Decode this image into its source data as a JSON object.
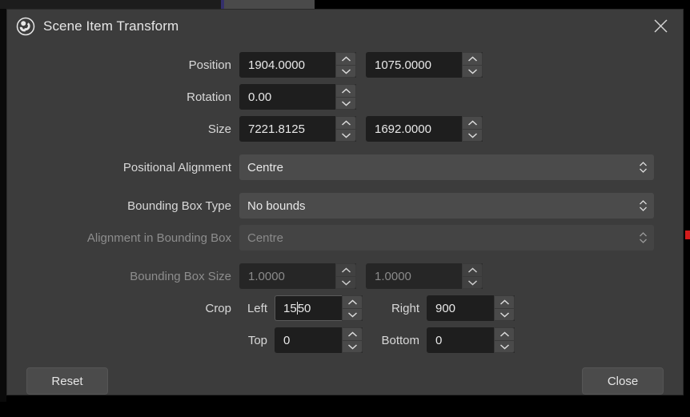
{
  "window": {
    "title": "Scene Item Transform",
    "logo_icon": "obs-logo-icon",
    "close_icon": "close-icon"
  },
  "form": {
    "position": {
      "label": "Position",
      "x_value": "1904.0000",
      "y_value": "1075.0000"
    },
    "rotation": {
      "label": "Rotation",
      "value": "0.00"
    },
    "size": {
      "label": "Size",
      "width_value": "7221.8125",
      "height_value": "1692.0000"
    },
    "positional_alignment": {
      "label": "Positional Alignment",
      "value": "Centre"
    },
    "bounding_box_type": {
      "label": "Bounding Box Type",
      "value": "No bounds"
    },
    "alignment_in_bounding_box": {
      "label": "Alignment in Bounding Box",
      "value": "Centre"
    },
    "bounding_box_size": {
      "label": "Bounding Box Size",
      "width_value": "1.0000",
      "height_value": "1.0000"
    },
    "crop": {
      "label": "Crop",
      "left_label": "Left",
      "left_value_before_caret": "15",
      "left_value_after_caret": "50",
      "right_label": "Right",
      "right_value": "900",
      "top_label": "Top",
      "top_value": "0",
      "bottom_label": "Bottom",
      "bottom_value": "0"
    }
  },
  "footer": {
    "reset_label": "Reset",
    "close_label": "Close"
  },
  "icons": {
    "stepper_up": "chevron-up-icon",
    "stepper_down": "chevron-down-icon",
    "combo_updown": "chevron-updown-icon"
  },
  "colors": {
    "dialog_bg": "#3c3c3c",
    "field_bg": "#1e1e1e",
    "combo_bg": "#4b4b4b",
    "text": "#e8e8e8",
    "text_disabled": "#8a8a8a",
    "accent_marker": "#34306b",
    "red_marker": "#d31b1b"
  }
}
